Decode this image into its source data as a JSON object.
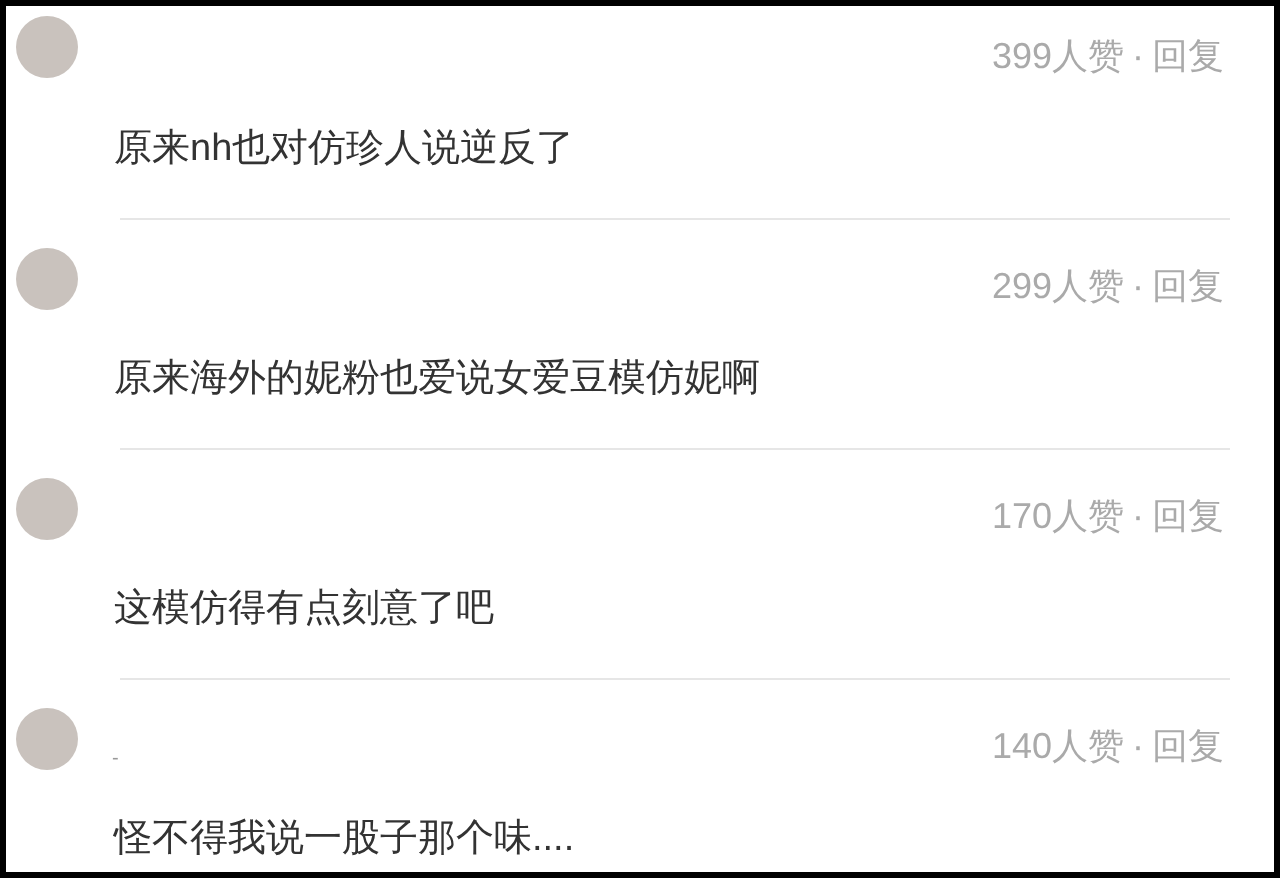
{
  "comments": [
    {
      "likes": "399人赞",
      "separator": "·",
      "reply": "回复",
      "text": "原来nh也对仿珍人说逆反了"
    },
    {
      "likes": "299人赞",
      "separator": "·",
      "reply": "回复",
      "text": "原来海外的妮粉也爱说女爱豆模仿妮啊"
    },
    {
      "likes": "170人赞",
      "separator": "·",
      "reply": "回复",
      "text": "这模仿得有点刻意了吧"
    },
    {
      "username": "-",
      "likes": "140人赞",
      "separator": "·",
      "reply": "回复",
      "text": "怪不得我说一股子那个味...."
    }
  ]
}
